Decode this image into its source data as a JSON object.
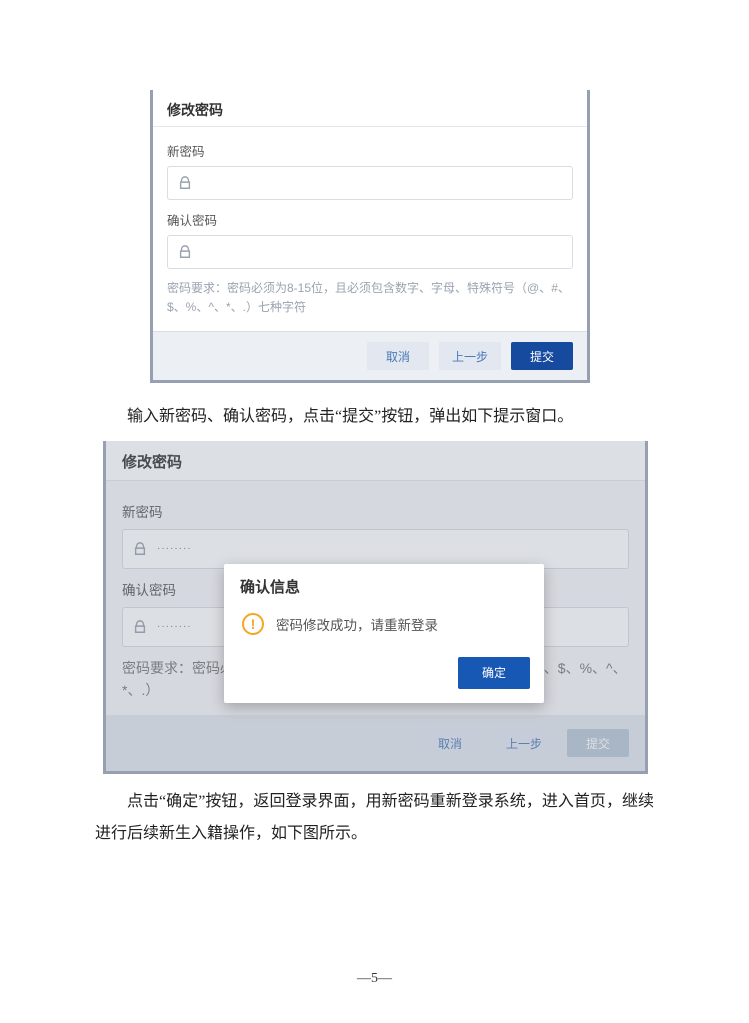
{
  "shot1": {
    "title": "修改密码",
    "new_pwd_label": "新密码",
    "confirm_pwd_label": "确认密码",
    "requirement": "密码要求：密码必须为8-15位，且必须包含数字、字母、特殊符号（@、#、$、%、^、*、.）七种字符",
    "btn_cancel": "取消",
    "btn_prev": "上一步",
    "btn_submit": "提交"
  },
  "para1": "输入新密码、确认密码，点击“提交”按钮，弹出如下提示窗口。",
  "shot2": {
    "title": "修改密码",
    "new_pwd_label": "新密码",
    "confirm_pwd_label": "确认密码",
    "dots": "········",
    "requirement_left": "密码要求：密码必",
    "requirement_right": "诛符号（@、#、$、%、^、*、.）",
    "btn_cancel": "取消",
    "btn_prev": "上一步",
    "btn_submit": "提交",
    "modal": {
      "title": "确认信息",
      "message": "密码修改成功，请重新登录",
      "ok": "确定"
    }
  },
  "para2": "点击“确定”按钮，返回登录界面，用新密码重新登录系统，进入首页，继续进行后续新生入籍操作，如下图所示。",
  "page_number": "—5—"
}
